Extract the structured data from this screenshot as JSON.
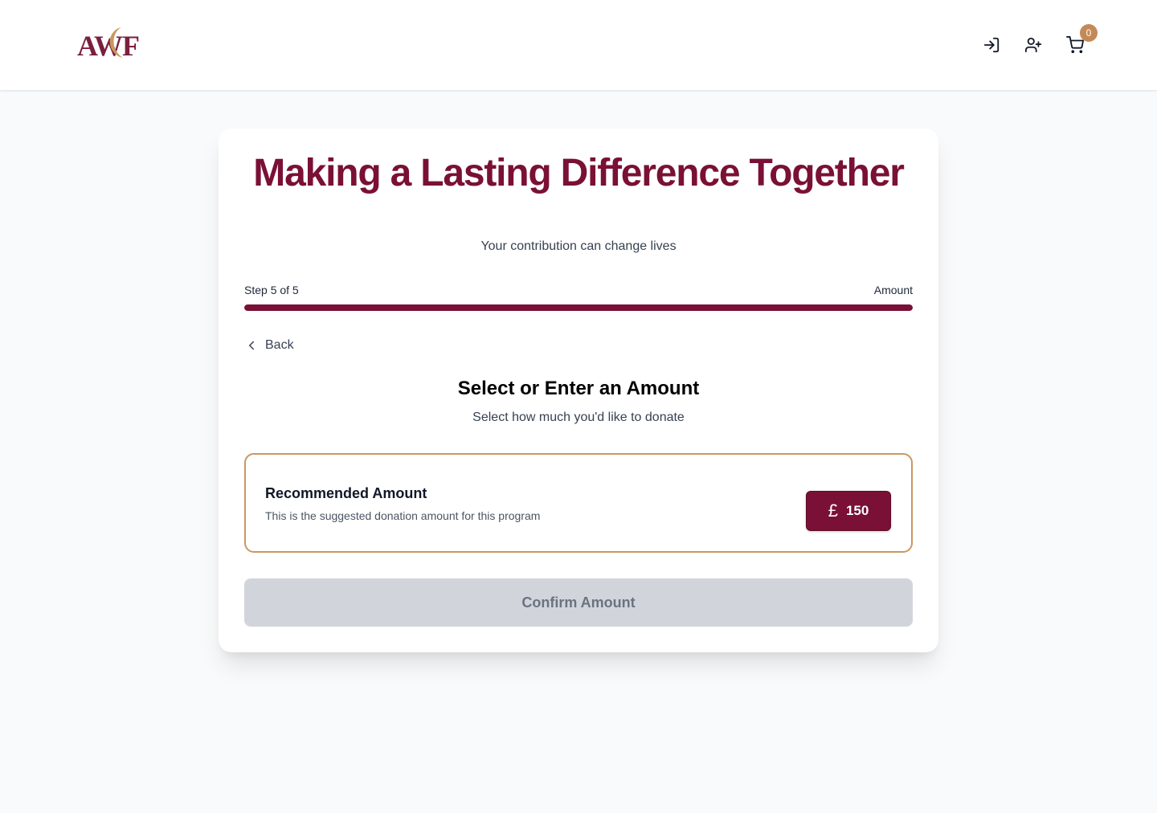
{
  "header": {
    "logo_text": "AWF",
    "icons": [
      "login-icon",
      "user-plus-icon",
      "cart-icon"
    ],
    "cart_count": "0"
  },
  "hero": {
    "title": "Making a Lasting Difference Together",
    "subtitle": "Your contribution can change lives"
  },
  "progress": {
    "step_label": "Step 5 of 5",
    "step_name": "Amount",
    "fraction": 1.0
  },
  "back_label": "Back",
  "amount_section": {
    "title": "Select or Enter an Amount",
    "subtitle": "Select how much you'd like to donate"
  },
  "recommended": {
    "title": "Recommended Amount",
    "description": "This is the suggested donation amount for this program",
    "currency_symbol": "£",
    "amount": "150"
  },
  "confirm_label": "Confirm Amount",
  "colors": {
    "brand": "#7a1035",
    "accent_gold": "#c9985f",
    "disabled_bg": "#d1d5db"
  }
}
